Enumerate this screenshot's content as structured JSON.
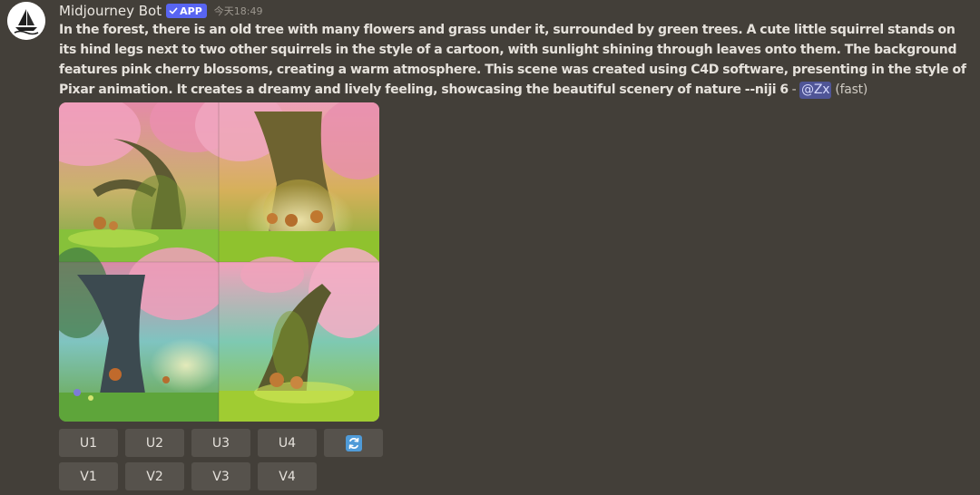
{
  "message": {
    "avatar_icon": "midjourney-boat-icon",
    "username": "Midjourney Bot",
    "badge": {
      "icon": "checkmark-icon",
      "label": "APP",
      "color": "#5865f2"
    },
    "timestamp": "今天18:49",
    "prompt": "In the forest, there is an old tree with many flowers and grass under it, surrounded by green trees. A cute little squirrel stands on its hind legs next to two other squirrels in the style of a cartoon, with sunlight shining through leaves onto them. The background features pink cherry blossoms, creating a warm atmosphere. This scene was created using C4D software, presenting in the style of Pixar animation. It creates a dreamy and lively feeling, showcasing the beautiful scenery of nature --niji 6",
    "separator": " - ",
    "mention": "@Zx",
    "mode": "(fast)"
  },
  "image_grid": {
    "description_icon": "generated-image-grid",
    "tile_count": 4
  },
  "buttons": {
    "upscale": [
      "U1",
      "U2",
      "U3",
      "U4"
    ],
    "reroll_icon": "refresh-icon",
    "reroll_color": "#4f9bd8",
    "variation": [
      "V1",
      "V2",
      "V3",
      "V4"
    ]
  },
  "colors": {
    "background": "#433f39",
    "button": "#56524c",
    "mention_bg": "#4f5596"
  }
}
